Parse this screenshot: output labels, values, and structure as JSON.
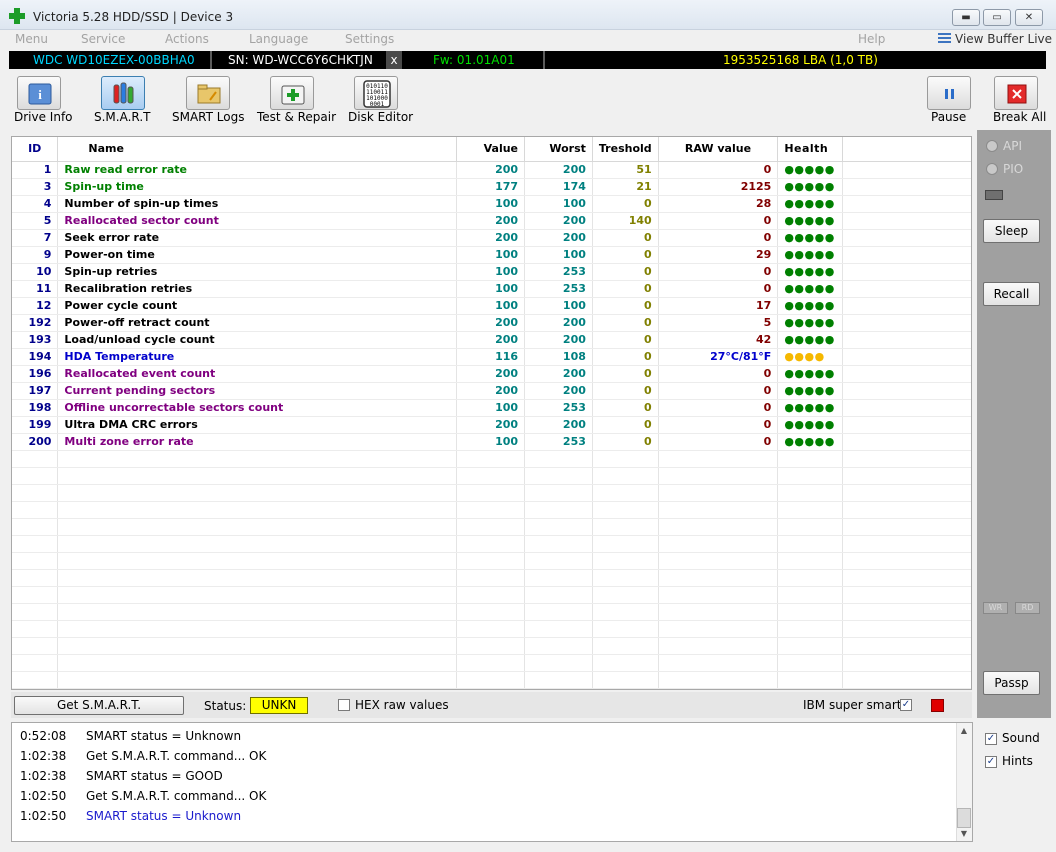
{
  "window": {
    "title": "Victoria 5.28 HDD/SSD | Device 3",
    "min_label": "▬",
    "max_label": "▭",
    "close_label": "✕"
  },
  "menu": {
    "items": [
      "Menu",
      "Service",
      "Actions",
      "Language",
      "Settings"
    ],
    "help": "Help",
    "view_buffer": "View Buffer Live"
  },
  "drive": {
    "model": "WDC WD10EZEX-00BBHA0",
    "serial": "SN: WD-WCC6Y6CHKTJN",
    "close": "x",
    "firmware": "Fw: 01.01A01",
    "capacity": "1953525168 LBA (1,0 TB)",
    "colors": {
      "model": "#00d8ff",
      "serial": "#ffffff",
      "firmware": "#00e000",
      "capacity": "#ffff00"
    }
  },
  "toolbar": {
    "drive_info": "Drive Info",
    "smart": "S.M.A.R.T",
    "smart_logs": "SMART Logs",
    "test_repair": "Test & Repair",
    "disk_editor": "Disk Editor",
    "disk_editor_icon_text": "010110\n110011\n101000\n0001",
    "pause": "Pause",
    "break_all": "Break All"
  },
  "table": {
    "headers": {
      "id": "ID",
      "name": "Name",
      "value": "Value",
      "worst": "Worst",
      "threshold": "Treshold",
      "raw": "RAW value",
      "health": "Health"
    },
    "rows": [
      {
        "id": "1",
        "name": "Raw read error rate",
        "value": "200",
        "worst": "200",
        "threshold": "51",
        "raw": "0",
        "health": "●●●●●",
        "name_color": "#008000"
      },
      {
        "id": "3",
        "name": "Spin-up time",
        "value": "177",
        "worst": "174",
        "threshold": "21",
        "raw": "2125",
        "health": "●●●●●",
        "name_color": "#008000"
      },
      {
        "id": "4",
        "name": "Number of spin-up times",
        "value": "100",
        "worst": "100",
        "threshold": "0",
        "raw": "28",
        "health": "●●●●●",
        "name_color": "#000000"
      },
      {
        "id": "5",
        "name": "Reallocated sector count",
        "value": "200",
        "worst": "200",
        "threshold": "140",
        "raw": "0",
        "health": "●●●●●",
        "name_color": "#800080"
      },
      {
        "id": "7",
        "name": "Seek error rate",
        "value": "200",
        "worst": "200",
        "threshold": "0",
        "raw": "0",
        "health": "●●●●●",
        "name_color": "#000000"
      },
      {
        "id": "9",
        "name": "Power-on time",
        "value": "100",
        "worst": "100",
        "threshold": "0",
        "raw": "29",
        "health": "●●●●●",
        "name_color": "#000000"
      },
      {
        "id": "10",
        "name": "Spin-up retries",
        "value": "100",
        "worst": "253",
        "threshold": "0",
        "raw": "0",
        "health": "●●●●●",
        "name_color": "#000000"
      },
      {
        "id": "11",
        "name": "Recalibration retries",
        "value": "100",
        "worst": "253",
        "threshold": "0",
        "raw": "0",
        "health": "●●●●●",
        "name_color": "#000000"
      },
      {
        "id": "12",
        "name": "Power cycle count",
        "value": "100",
        "worst": "100",
        "threshold": "0",
        "raw": "17",
        "health": "●●●●●",
        "name_color": "#000000"
      },
      {
        "id": "192",
        "name": "Power-off retract count",
        "value": "200",
        "worst": "200",
        "threshold": "0",
        "raw": "5",
        "health": "●●●●●",
        "name_color": "#000000"
      },
      {
        "id": "193",
        "name": "Load/unload cycle count",
        "value": "200",
        "worst": "200",
        "threshold": "0",
        "raw": "42",
        "health": "●●●●●",
        "name_color": "#000000"
      },
      {
        "id": "194",
        "name": "HDA Temperature",
        "value": "116",
        "worst": "108",
        "threshold": "0",
        "raw": "27°C/81°F",
        "health": "●●●●",
        "name_color": "#0000cc"
      },
      {
        "id": "196",
        "name": "Reallocated event count",
        "value": "200",
        "worst": "200",
        "threshold": "0",
        "raw": "0",
        "health": "●●●●●",
        "name_color": "#800080"
      },
      {
        "id": "197",
        "name": "Current pending sectors",
        "value": "200",
        "worst": "200",
        "threshold": "0",
        "raw": "0",
        "health": "●●●●●",
        "name_color": "#800080"
      },
      {
        "id": "198",
        "name": "Offline uncorrectable sectors count",
        "value": "100",
        "worst": "253",
        "threshold": "0",
        "raw": "0",
        "health": "●●●●●",
        "name_color": "#800080"
      },
      {
        "id": "199",
        "name": "Ultra DMA CRC errors",
        "value": "200",
        "worst": "200",
        "threshold": "0",
        "raw": "0",
        "health": "●●●●●",
        "name_color": "#000000"
      },
      {
        "id": "200",
        "name": "Multi zone error rate",
        "value": "100",
        "worst": "253",
        "threshold": "0",
        "raw": "0",
        "health": "●●●●●",
        "name_color": "#800080"
      }
    ]
  },
  "right_panel": {
    "api": "API",
    "pio": "PIO",
    "sleep": "Sleep",
    "recall": "Recall",
    "wr": "WR",
    "rd": "RD",
    "passp": "Passp"
  },
  "bottom": {
    "get_smart": "Get S.M.A.R.T.",
    "status_label": "Status:",
    "status_value": "UNKN",
    "hex_raw": "HEX raw values",
    "ibm_super_smart": "IBM super smart:",
    "check_mark": "✓"
  },
  "log": [
    {
      "time": "0:52:08",
      "msg": "SMART status = Unknown",
      "color": "#000000"
    },
    {
      "time": "1:02:38",
      "msg": "Get S.M.A.R.T. command... OK",
      "color": "#000000"
    },
    {
      "time": "1:02:38",
      "msg": "SMART status = GOOD",
      "color": "#000000"
    },
    {
      "time": "1:02:50",
      "msg": "Get S.M.A.R.T. command... OK",
      "color": "#000000"
    },
    {
      "time": "1:02:50",
      "msg": "SMART status = Unknown",
      "color": "#1a1acc"
    }
  ],
  "side_options": {
    "sound": "Sound",
    "hints": "Hints"
  }
}
